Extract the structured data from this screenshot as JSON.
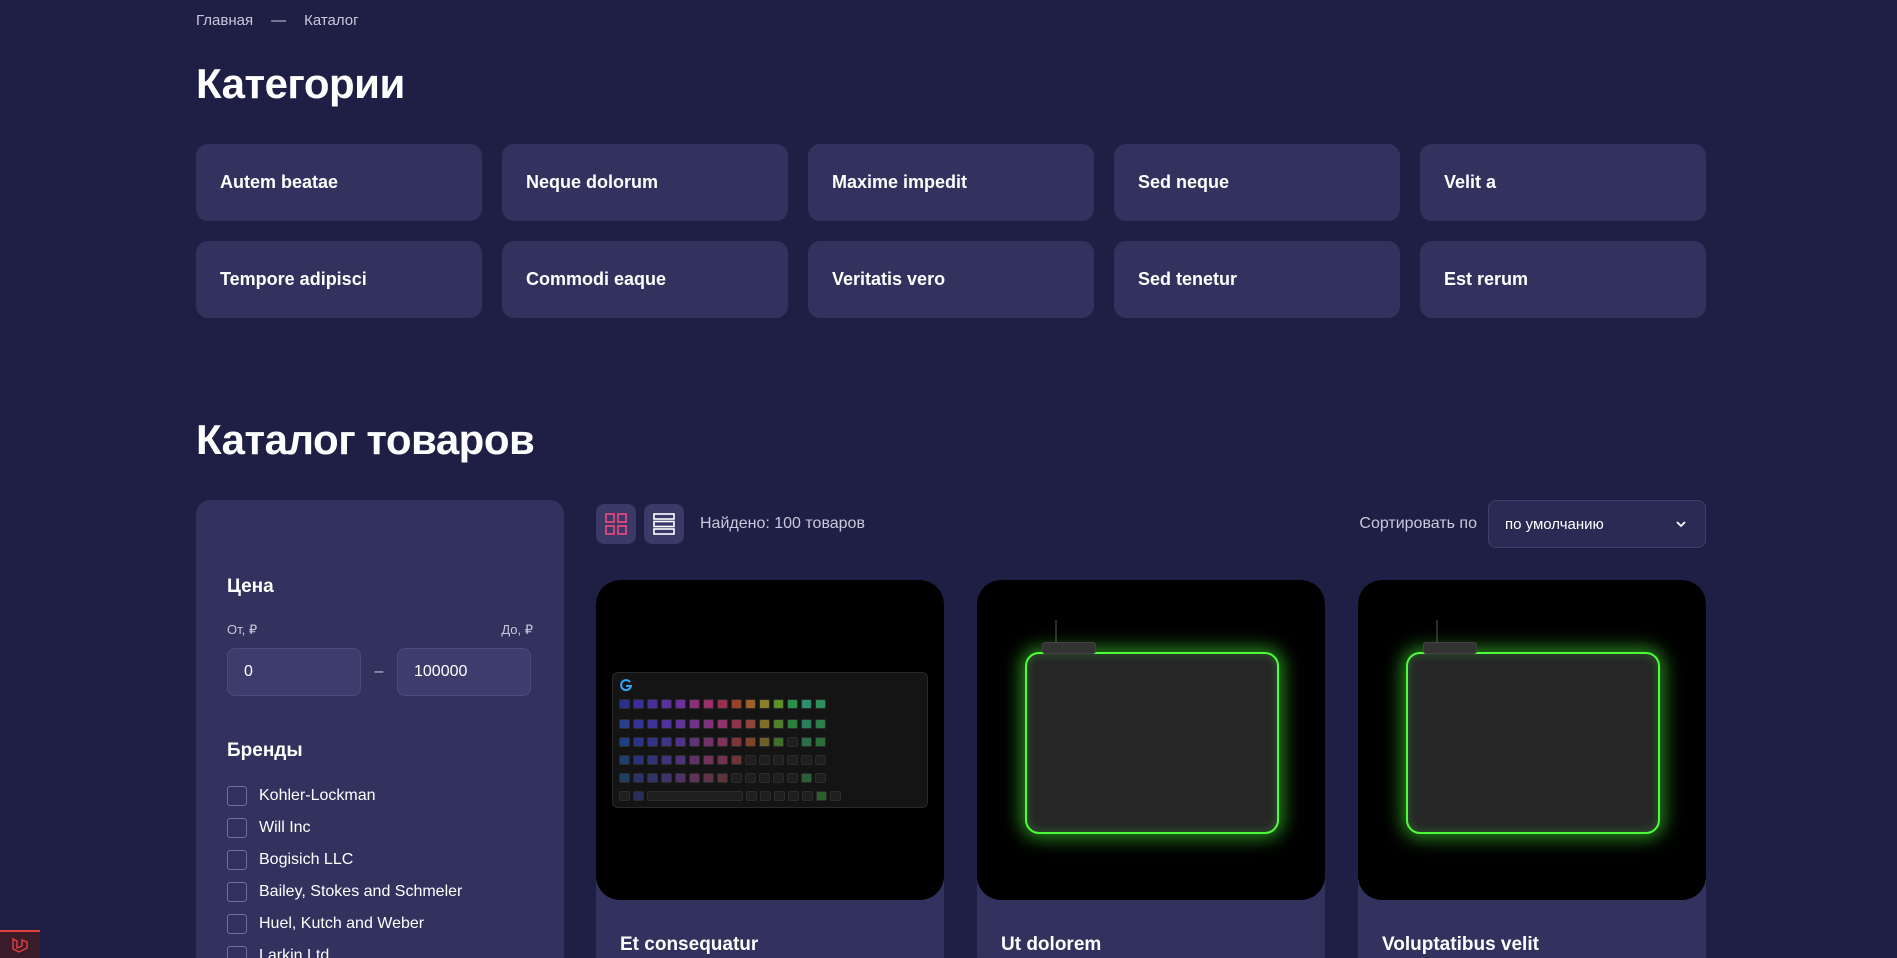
{
  "breadcrumb": {
    "home": "Главная",
    "separator": "—",
    "current": "Каталог"
  },
  "categories": {
    "title": "Категории",
    "items": [
      "Autem beatae",
      "Neque dolorum",
      "Maxime impedit",
      "Sed neque",
      "Velit a",
      "Tempore adipisci",
      "Commodi eaque",
      "Veritatis vero",
      "Sed tenetur",
      "Est rerum"
    ]
  },
  "catalog": {
    "title": "Каталог товаров",
    "found_text": "Найдено: 100 товаров",
    "sort_label": "Сортировать по",
    "sort_value": "по умолчанию"
  },
  "filters": {
    "price_title": "Цена",
    "from_label": "От, ₽",
    "to_label": "До, ₽",
    "from_value": "0",
    "to_value": "100000",
    "dash": "–",
    "brands_title": "Бренды",
    "brands": [
      "Kohler-Lockman",
      "Will Inc",
      "Bogisich LLC",
      "Bailey, Stokes and Schmeler",
      "Huel, Kutch and Weber",
      "Larkin Ltd"
    ]
  },
  "products": [
    {
      "title": "Et consequatur",
      "image": "keyboard"
    },
    {
      "title": "Ut dolorem",
      "image": "mousepad"
    },
    {
      "title": "Voluptatibus velit",
      "image": "mousepad"
    }
  ],
  "colors": {
    "background": "#1f1e44",
    "card": "#33315e",
    "accent": "#e0457b",
    "glow": "#4dff3a"
  }
}
